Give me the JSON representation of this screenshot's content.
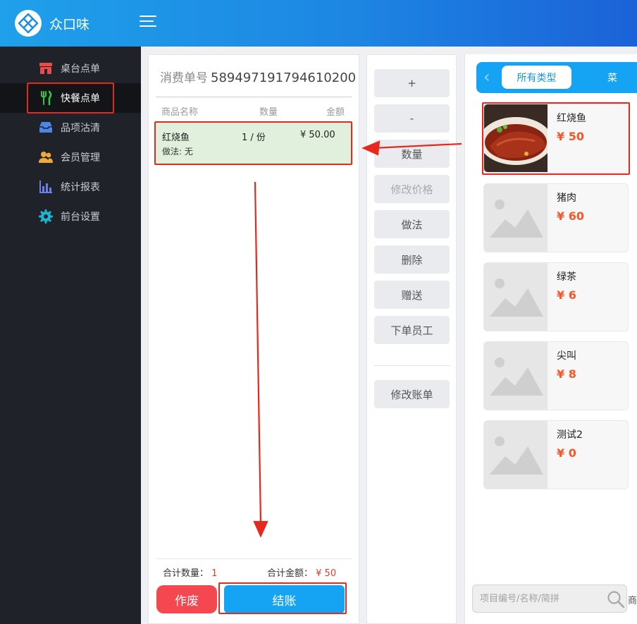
{
  "app": {
    "title": "众口味"
  },
  "sidebar": {
    "items": [
      {
        "label": "桌台点单",
        "icon": "store-icon",
        "active": false,
        "color": "#e84c4c"
      },
      {
        "label": "快餐点单",
        "icon": "fork-knife-icon",
        "active": true,
        "color": "#35c448"
      },
      {
        "label": "品项沽清",
        "icon": "inbox-icon",
        "active": false,
        "color": "#4c86e8"
      },
      {
        "label": "会员管理",
        "icon": "users-icon",
        "active": false,
        "color": "#f0a93c"
      },
      {
        "label": "统计报表",
        "icon": "bar-chart-icon",
        "active": false,
        "color": "#6a7fe0"
      },
      {
        "label": "前台设置",
        "icon": "gear-icon",
        "active": false,
        "color": "#1db6d2"
      }
    ]
  },
  "order": {
    "title_label": "消费单号",
    "number": "589497191794610200",
    "columns": {
      "name": "商品名称",
      "qty": "数量",
      "amount": "金额"
    },
    "items": [
      {
        "name": "红烧鱼",
        "qty": "1 / 份",
        "amount": "¥ 50.00",
        "method": "做法: 无"
      }
    ],
    "summary": {
      "qty_label": "合计数量：",
      "qty_value": "1",
      "amount_label": "合计金额：",
      "amount_value": "¥ 50"
    },
    "void_label": "作废",
    "pay_label": "结账"
  },
  "actions": {
    "buttons": [
      {
        "label": "+",
        "disabled": false
      },
      {
        "label": "-",
        "disabled": false
      },
      {
        "label": "数量",
        "disabled": false
      },
      {
        "label": "修改价格",
        "disabled": true
      },
      {
        "label": "做法",
        "disabled": false
      },
      {
        "label": "删除",
        "disabled": false
      },
      {
        "label": "赠送",
        "disabled": false
      },
      {
        "label": "下单员工",
        "disabled": false
      }
    ],
    "edit_bill_label": "修改账单"
  },
  "products": {
    "categories": {
      "active": "所有类型",
      "next": "菜"
    },
    "items": [
      {
        "name": "红烧鱼",
        "price": "¥ 50",
        "has_photo": true
      },
      {
        "name": "猪肉",
        "price": "¥ 60",
        "has_photo": false
      },
      {
        "name": "绿茶",
        "price": "¥ 6",
        "has_photo": false
      },
      {
        "name": "尖叫",
        "price": "¥ 8",
        "has_photo": false
      },
      {
        "name": "测试2",
        "price": "¥ 0",
        "has_photo": false
      }
    ],
    "search": {
      "placeholder": "项目编号/名称/简拼",
      "extra": "商"
    }
  },
  "theme": {
    "accent": "#15a3f4",
    "danger": "#f5474f",
    "price": "#f2582a",
    "annotation": "#e8281c"
  }
}
